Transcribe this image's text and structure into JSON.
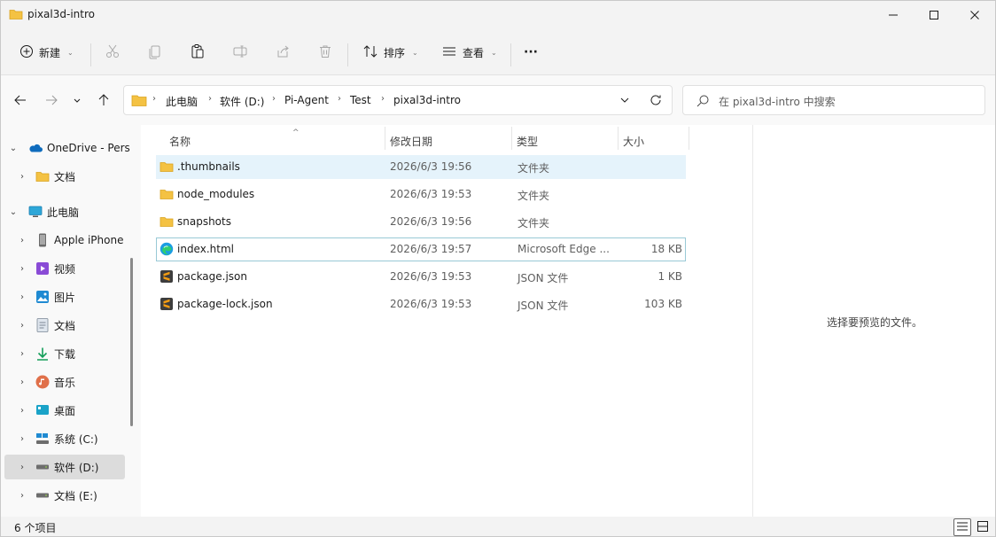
{
  "window": {
    "title": "pixal3d-intro",
    "minimize_glyph": "—",
    "maximize_glyph": "☐",
    "close_glyph": "✕"
  },
  "toolbar": {
    "new_label": "新建",
    "sort_label": "排序",
    "view_label": "查看",
    "more_label": "···",
    "icons": [
      "plus-circle-icon",
      "cut-icon",
      "copy-icon",
      "paste-icon",
      "rename-icon",
      "share-icon",
      "delete-icon",
      "sort-icon",
      "view-icon",
      "more-icon"
    ]
  },
  "address": {
    "crumbs": [
      "此电脑",
      "软件 (D:)",
      "Pi-Agent",
      "Test",
      "pixal3d-intro"
    ],
    "search_placeholder": "在 pixal3d-intro 中搜索"
  },
  "sidebar": {
    "items": [
      {
        "label": "OneDrive - Pers",
        "icon": "onedrive-icon",
        "level": 0,
        "expanded": true
      },
      {
        "label": "文档",
        "icon": "folder-icon",
        "level": 1,
        "expanded": false
      },
      {
        "label": "此电脑",
        "icon": "pc-icon",
        "level": 0,
        "expanded": true
      },
      {
        "label": "Apple iPhone",
        "icon": "phone-icon",
        "level": 1,
        "expanded": false
      },
      {
        "label": "视频",
        "icon": "video-icon",
        "level": 1,
        "expanded": false
      },
      {
        "label": "图片",
        "icon": "pictures-icon",
        "level": 1,
        "expanded": false
      },
      {
        "label": "文档",
        "icon": "documents-icon",
        "level": 1,
        "expanded": false
      },
      {
        "label": "下载",
        "icon": "download-icon",
        "level": 1,
        "expanded": false
      },
      {
        "label": "音乐",
        "icon": "music-icon",
        "level": 1,
        "expanded": false
      },
      {
        "label": "桌面",
        "icon": "desktop-icon",
        "level": 1,
        "expanded": false
      },
      {
        "label": "系统 (C:)",
        "icon": "system-drive-icon",
        "level": 1,
        "expanded": false
      },
      {
        "label": "软件 (D:)",
        "icon": "drive-icon",
        "level": 1,
        "expanded": false,
        "selected": true
      },
      {
        "label": "文档 (E:)",
        "icon": "drive-icon",
        "level": 1,
        "expanded": false
      }
    ]
  },
  "columns": {
    "name": "名称",
    "date": "修改日期",
    "type": "类型",
    "size": "大小"
  },
  "files": [
    {
      "name": ".thumbnails",
      "date": "2026/6/3 19:56",
      "type": "文件夹",
      "size": "",
      "icon": "folder-icon",
      "state": "selected"
    },
    {
      "name": "node_modules",
      "date": "2026/6/3 19:53",
      "type": "文件夹",
      "size": "",
      "icon": "folder-icon"
    },
    {
      "name": "snapshots",
      "date": "2026/6/3 19:56",
      "type": "文件夹",
      "size": "",
      "icon": "folder-icon"
    },
    {
      "name": "index.html",
      "date": "2026/6/3 19:57",
      "type": "Microsoft Edge ...",
      "size": "18 KB",
      "icon": "edge-icon",
      "state": "focus"
    },
    {
      "name": "package.json",
      "date": "2026/6/3 19:53",
      "type": "JSON 文件",
      "size": "1 KB",
      "icon": "sublime-icon"
    },
    {
      "name": "package-lock.json",
      "date": "2026/6/3 19:53",
      "type": "JSON 文件",
      "size": "103 KB",
      "icon": "sublime-icon"
    }
  ],
  "preview": {
    "message": "选择要预览的文件。"
  },
  "status": {
    "count": "6 个项目"
  },
  "colors": {
    "selected_row": "#e5f3fb",
    "focus_border": "#99c9d6",
    "folder": "#f4c243",
    "accent": "#0067c0"
  }
}
